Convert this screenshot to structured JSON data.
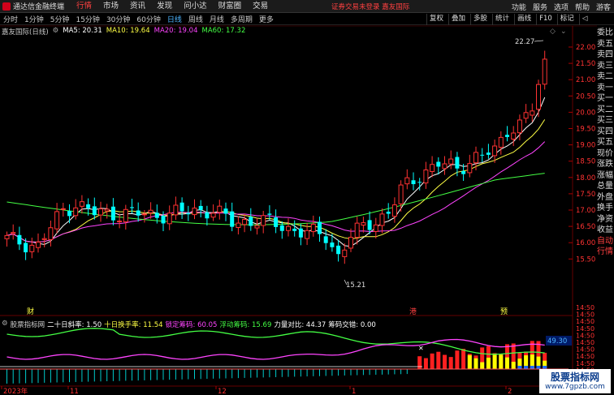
{
  "window": {
    "app_title": "通达信金融终端",
    "menu": [
      "行情",
      "市场",
      "资讯",
      "发现",
      "问小达",
      "财富圈",
      "交易"
    ],
    "active_menu": 0,
    "status": "证券交易未登录 嘉友国际",
    "right_items": [
      "功能",
      "服务",
      "选项",
      "帮助",
      "游客"
    ]
  },
  "toolbar": {
    "periods": [
      "分时",
      "1分钟",
      "5分钟",
      "15分钟",
      "30分钟",
      "60分钟",
      "日线",
      "周线",
      "月线",
      "多周期",
      "更多"
    ],
    "active_period": 6,
    "buttons": [
      "复权",
      "叠加",
      "多股",
      "统计",
      "画线",
      "F10",
      "标记",
      "◁"
    ]
  },
  "chart_header": {
    "stock": "嘉友国际(日线)",
    "ma5": "MA5: 20.31",
    "ma10": "MA10: 19.64",
    "ma20": "MA20: 19.04",
    "ma60": "MA60: 17.32"
  },
  "price_axis": [
    "22.00",
    "21.50",
    "21.00",
    "20.50",
    "20.00",
    "19.50",
    "19.00",
    "18.50",
    "18.00",
    "17.50",
    "17.00",
    "16.50",
    "16.00",
    "15.50"
  ],
  "annotations": {
    "high": "22.27",
    "low": "15.21",
    "markers": [
      "财",
      "港",
      "预"
    ]
  },
  "indicator": {
    "name": "股票指标网",
    "items": [
      {
        "text": "二十日斜率: 1.50",
        "color": "white"
      },
      {
        "text": "十日换手率: 11.54",
        "color": "yellow"
      },
      {
        "text": "锁定筹码: 60.05",
        "color": "magenta"
      },
      {
        "text": "浮动筹码: 15.69",
        "color": "green"
      },
      {
        "text": "力量对比: 44.37",
        "color": "white"
      },
      {
        "text": "筹码交错: 0.00",
        "color": "white"
      }
    ],
    "axis_value": "49.30"
  },
  "date_axis": [
    "2023年",
    "11",
    "12",
    "1",
    "2"
  ],
  "right_panel": [
    "委比",
    "卖五",
    "卖四",
    "卖三",
    "卖二",
    "卖一",
    "买一",
    "买二",
    "买三",
    "买四",
    "买五",
    "现价",
    "涨跌",
    "涨幅",
    "总量",
    "外盘",
    "换手",
    "净资",
    "收益",
    "自动",
    "行情"
  ],
  "time_axis": [
    "14:50",
    "14:50",
    "14:50",
    "14:50",
    "14:50",
    "14:50",
    "14:50",
    "14:50",
    "14:50",
    "14:50",
    "14:50",
    "14:50"
  ],
  "watermark": {
    "line1": "股票指标网",
    "line2": "www.7gpzb.com"
  },
  "colors": {
    "up": "#ff3232",
    "down": "#00ffff",
    "ma5": "#ffffff",
    "ma10": "#ffff44",
    "ma20": "#ff44ff",
    "ma60": "#44ff44"
  }
}
